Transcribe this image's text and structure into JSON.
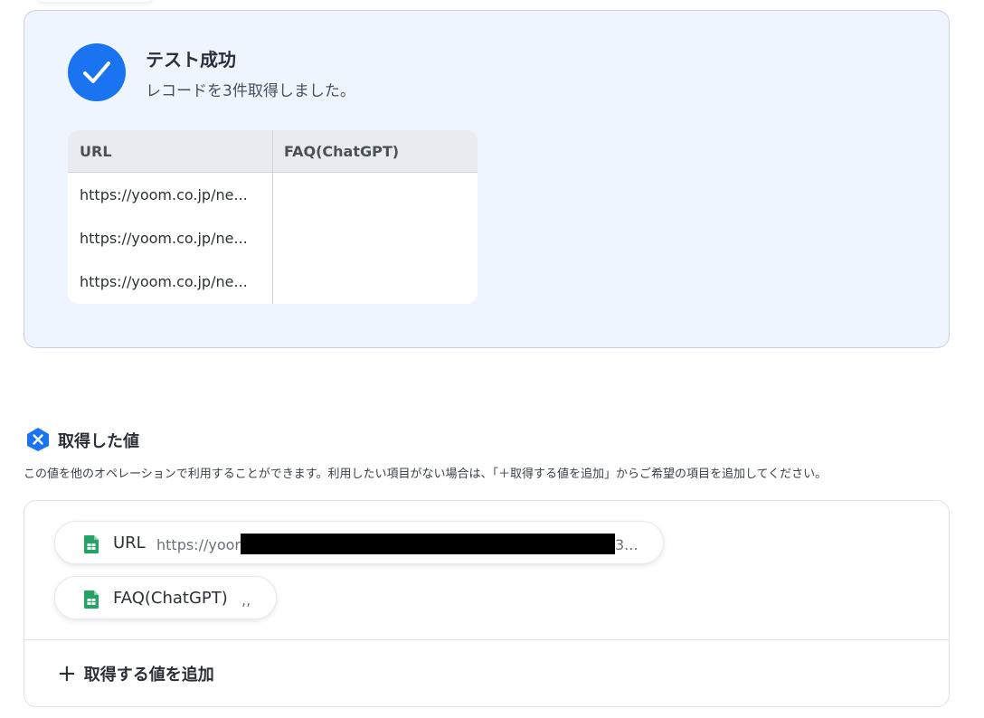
{
  "result": {
    "title": "テスト成功",
    "subtitle": "レコードを3件取得しました。",
    "table": {
      "columns": [
        "URL",
        "FAQ(ChatGPT)"
      ],
      "rows": [
        [
          "https://yoom.co.jp/ne...",
          ""
        ],
        [
          "https://yoom.co.jp/ne...",
          ""
        ],
        [
          "https://yoom.co.jp/ne...",
          ""
        ]
      ]
    }
  },
  "values_section": {
    "title": "取得した値",
    "description": "この値を他のオペレーションで利用することができます。利用したい項目がない場合は、「＋取得する値を追加」からご希望の項目を追加してください。",
    "items": [
      {
        "name": "URL",
        "value": "https://yoor",
        "value_tail": "3...",
        "icon": "google-sheets-icon"
      },
      {
        "name": "FAQ(ChatGPT)",
        "value": ",,",
        "icon": "google-sheets-icon"
      }
    ],
    "add_label": "取得する値を追加"
  },
  "colors": {
    "accent": "#1a73f0",
    "panel_bg": "#eef5ff",
    "sheets_green": "#21a464"
  }
}
